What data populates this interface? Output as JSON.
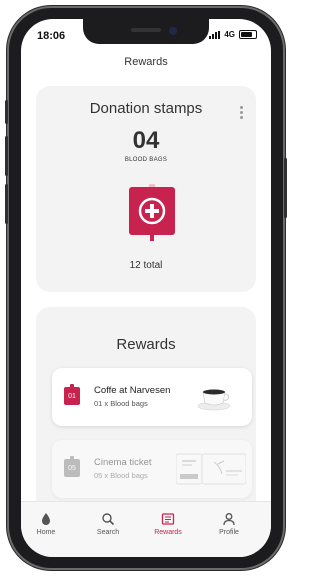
{
  "status": {
    "time": "18:06",
    "network": "4G"
  },
  "header": {
    "title": "Rewards"
  },
  "stamps": {
    "title": "Donation stamps",
    "count": "04",
    "unit": "BLOOD BAGS",
    "total": "12 total"
  },
  "rewards_section": {
    "title": "Rewards",
    "items": [
      {
        "number": "01",
        "name": "Coffe at Narvesen",
        "detail": "01 x Blood bags",
        "badge_color": "#c8224f"
      },
      {
        "number": "05",
        "name": "Cinema ticket",
        "detail": "05 x Blood bags",
        "badge_color": "#7a7a7a"
      }
    ]
  },
  "tabs": [
    {
      "label": "Home",
      "icon": "drop-icon"
    },
    {
      "label": "Search",
      "icon": "search-icon"
    },
    {
      "label": "Rewards",
      "icon": "rewards-icon"
    },
    {
      "label": "Profile",
      "icon": "profile-icon"
    }
  ],
  "colors": {
    "accent": "#c8224f",
    "card_bg": "#f3f3f4"
  }
}
